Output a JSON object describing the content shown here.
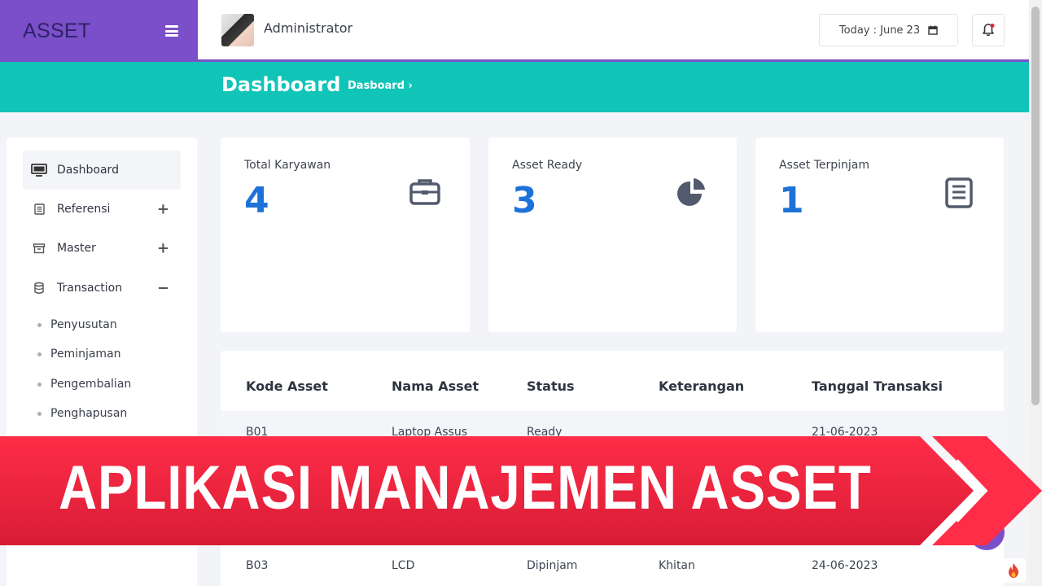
{
  "app": {
    "brand": "ASSET",
    "user": "Administrator",
    "date": "Today : June 23"
  },
  "header": {
    "title": "Dashboard",
    "breadcrumb": "Dasboard ›"
  },
  "sidebar": {
    "items": [
      {
        "label": "Dashboard",
        "icon": "monitor-icon",
        "toggle": ""
      },
      {
        "label": "Referensi",
        "icon": "list-icon",
        "toggle": "+"
      },
      {
        "label": "Master",
        "icon": "archive-icon",
        "toggle": "+"
      },
      {
        "label": "Transaction",
        "icon": "database-icon",
        "toggle": "−"
      }
    ],
    "subitems": [
      "Penyusutan",
      "Peminjaman",
      "Pengembalian",
      "Penghapusan"
    ]
  },
  "cards": [
    {
      "label": "Total Karyawan",
      "value": "4",
      "icon": "briefcase-icon"
    },
    {
      "label": "Asset Ready",
      "value": "3",
      "icon": "pie-chart-icon"
    },
    {
      "label": "Asset Terpinjam",
      "value": "1",
      "icon": "clipboard-icon"
    }
  ],
  "table": {
    "headers": [
      "Kode Asset",
      "Nama Asset",
      "Status",
      "Keterangan",
      "Tanggal Transaksi"
    ],
    "rows": [
      [
        "B01",
        "Laptop Assus",
        "Ready",
        "",
        "21-06-2023"
      ],
      [
        "B03",
        "LCD",
        "Dipinjam",
        "Khitan",
        "24-06-2023"
      ]
    ]
  },
  "banner": {
    "text": "APLIKASI MANAJEMEN ASSET"
  },
  "colors": {
    "brand_purple": "#7b4fc9",
    "teal": "#11c4b8",
    "value_blue": "#1d72d8",
    "banner_red": "#e8233e"
  }
}
